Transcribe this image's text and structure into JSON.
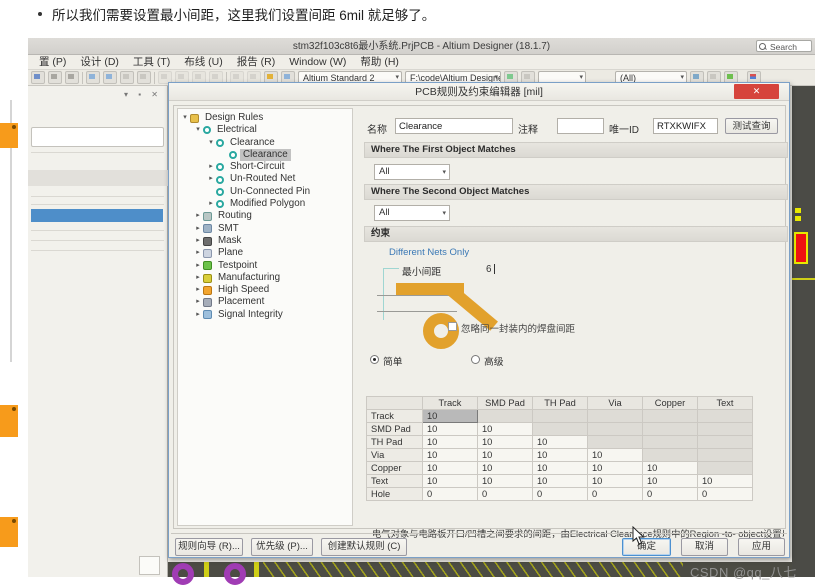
{
  "page": {
    "bullet": "所以我们需要设置最小间距，这里我们设置间距 6mil 就足够了。",
    "watermark": "CSDN @qq_八七"
  },
  "window": {
    "title": "stm32f103c8t6最小系统.PrjPCB - Altium Designer (18.1.7)",
    "search_label": "Search",
    "menus": [
      "置 (P)",
      "设计 (D)",
      "工具 (T)",
      "布线 (U)",
      "报告 (R)",
      "Window (W)",
      "帮助 (H)"
    ],
    "toolbar": {
      "profile": "Altium Standard 2",
      "path": "F:\\code\\Altium Designe",
      "filter": "(All)"
    },
    "panel_controls": "▾ ▪ ✕"
  },
  "dialog": {
    "title": "PCB规则及约束编辑器 [mil]",
    "close_glyph": "✕",
    "tree": [
      {
        "label": "Design Rules",
        "depth": 0,
        "expander": "expanded",
        "icon": "folder",
        "selected": false
      },
      {
        "label": "Electrical",
        "depth": 1,
        "expander": "expanded",
        "icon": "rule",
        "selected": false
      },
      {
        "label": "Clearance",
        "depth": 2,
        "expander": "expanded",
        "icon": "rule",
        "selected": false
      },
      {
        "label": "Clearance",
        "depth": 3,
        "expander": "none",
        "icon": "rule",
        "selected": true
      },
      {
        "label": "Short-Circuit",
        "depth": 2,
        "expander": "collapsed",
        "icon": "rule",
        "selected": false
      },
      {
        "label": "Un-Routed Net",
        "depth": 2,
        "expander": "collapsed",
        "icon": "rule",
        "selected": false
      },
      {
        "label": "Un-Connected Pin",
        "depth": 2,
        "expander": "none",
        "icon": "rule",
        "selected": false
      },
      {
        "label": "Modified Polygon",
        "depth": 2,
        "expander": "collapsed",
        "icon": "rule",
        "selected": false
      },
      {
        "label": "Routing",
        "depth": 1,
        "expander": "collapsed",
        "icon": "routing",
        "selected": false
      },
      {
        "label": "SMT",
        "depth": 1,
        "expander": "collapsed",
        "icon": "smt",
        "selected": false
      },
      {
        "label": "Mask",
        "depth": 1,
        "expander": "collapsed",
        "icon": "mask",
        "selected": false
      },
      {
        "label": "Plane",
        "depth": 1,
        "expander": "collapsed",
        "icon": "plane",
        "selected": false
      },
      {
        "label": "Testpoint",
        "depth": 1,
        "expander": "collapsed",
        "icon": "testpoint",
        "selected": false
      },
      {
        "label": "Manufacturing",
        "depth": 1,
        "expander": "collapsed",
        "icon": "manufacturing",
        "selected": false
      },
      {
        "label": "High Speed",
        "depth": 1,
        "expander": "collapsed",
        "icon": "highspeed",
        "selected": false
      },
      {
        "label": "Placement",
        "depth": 1,
        "expander": "collapsed",
        "icon": "placement",
        "selected": false
      },
      {
        "label": "Signal Integrity",
        "depth": 1,
        "expander": "collapsed",
        "icon": "signal",
        "selected": false
      }
    ],
    "fields": {
      "name_label": "名称",
      "name_value": "Clearance",
      "comment_label": "注释",
      "comment_value": "",
      "uid_label": "唯一ID",
      "uid_value": "RTXKWIFX",
      "test_button": "测试查询"
    },
    "sections": {
      "first_match": "Where The First Object Matches",
      "second_match": "Where The Second Object Matches",
      "constraints": "约束"
    },
    "first_match_value": "All",
    "second_match_value": "All",
    "constraints": {
      "link": "Different Nets Only",
      "min_label": "最小间距",
      "min_value": "6",
      "ignore_label": "忽略同一封装内的焊盘间距",
      "mode_simple": "简单",
      "mode_advanced": "高级"
    },
    "matrix": {
      "columns": [
        "Track",
        "SMD Pad",
        "TH Pad",
        "Via",
        "Copper",
        "Text"
      ],
      "rows": [
        {
          "label": "Track",
          "values": [
            "10"
          ]
        },
        {
          "label": "SMD Pad",
          "values": [
            "10",
            "10"
          ]
        },
        {
          "label": "TH Pad",
          "values": [
            "10",
            "10",
            "10"
          ]
        },
        {
          "label": "Via",
          "values": [
            "10",
            "10",
            "10",
            "10"
          ]
        },
        {
          "label": "Copper",
          "values": [
            "10",
            "10",
            "10",
            "10",
            "10"
          ]
        },
        {
          "label": "Text",
          "values": [
            "10",
            "10",
            "10",
            "10",
            "10",
            "10"
          ]
        },
        {
          "label": "Hole",
          "values": [
            "0",
            "0",
            "0",
            "0",
            "0",
            "0"
          ]
        }
      ]
    },
    "note": "电气对象与电路板开口/凹槽之间要求的间距，由Electrical Clearance规则中的Region -to- object设置以及Board",
    "buttons": {
      "wizard": "规则向导 (R)...",
      "priority": "优先级 (P)...",
      "create_default": "创建默认规则 (C)",
      "ok": "确定",
      "cancel": "取消",
      "apply": "应用"
    }
  },
  "colors": {
    "selection_blue": "#4e8ec9",
    "close_red": "#d6443c",
    "copper_yellow": "#e2a12c",
    "link_blue": "#3a78b5",
    "sticker_orange": "#f79b1b",
    "pad_red": "#ee1111",
    "pad_purple": "#a03cb4"
  }
}
